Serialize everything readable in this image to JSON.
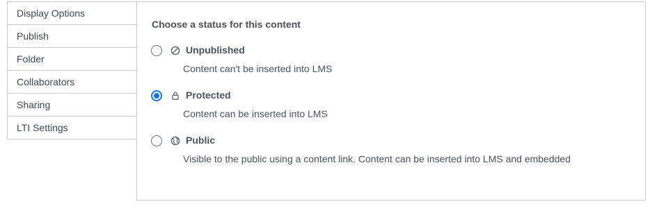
{
  "tabs": [
    {
      "label": "Display Options"
    },
    {
      "label": "Publish",
      "active": true
    },
    {
      "label": "Folder"
    },
    {
      "label": "Collaborators"
    },
    {
      "label": "Sharing"
    },
    {
      "label": "LTI Settings"
    }
  ],
  "publish": {
    "heading": "Choose a status for this content",
    "selected": "protected",
    "options": [
      {
        "id": "unpublished",
        "icon": "no-entry-icon",
        "label": "Unpublished",
        "description": "Content can't be inserted into LMS",
        "checked": false
      },
      {
        "id": "protected",
        "icon": "lock-icon",
        "label": "Protected",
        "description": "Content can be inserted into LMS",
        "checked": true
      },
      {
        "id": "public",
        "icon": "globe-icon",
        "label": "Public",
        "description": "Visible to the public using a content link. Content can be inserted into LMS and embedded",
        "checked": false
      }
    ]
  },
  "colors": {
    "accent": "#1a73e8",
    "border": "#c8ccd0",
    "text": "#4a535b"
  }
}
